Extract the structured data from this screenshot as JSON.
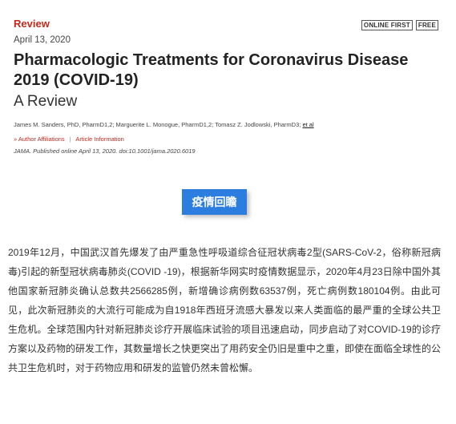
{
  "header": {
    "section": "Review",
    "badges": [
      "ONLINE FIRST",
      "FREE"
    ],
    "date": "April 13, 2020",
    "title": "Pharmacologic Treatments for Coronavirus Disease 2019 (COVID-19)",
    "subtitle": "A Review",
    "authors": "James M. Sanders, PhD, PharmD1,2; Marguerite L. Monogue, PharmD1,2; Tomasz Z. Jodlowski, PharmD3;",
    "authors_etal": "et al",
    "links": [
      "Author Affiliations",
      "Article Information"
    ],
    "citation": "JAMA. Published online April 13, 2020. doi:10.1001/jama.2020.6019"
  },
  "review_button": "疫情回瞻",
  "article_text": "2019年12月，中国武汉首先爆发了由严重急性呼吸道综合征冠状病毒2型(SARS-CoV-2，俗称新冠病毒)引起的新型冠状病毒肺炎(COVID -19)，根据新华网实时疫情数据显示，2020年4月23日除中国外其他国家新冠肺炎确认总数共2566285例，新增确诊病例数63537例，死亡病例数180104例。由此可见，此次新冠肺炎的大流行可能成为自1918年西班牙流感大暴发以来人类面临的最严重的全球公共卫生危机。全球范围内针对新冠肺炎诊疗开展临床试验的项目迅速启动，同步启动了对COVID-19的诊疗方案以及药物的研发工作，其数量增长之快更突出了用药安全仍旧是重中之重，即使在面临全球性的公共卫生危机时，对于药物应用和研发的监管仍然未曾松懈。"
}
